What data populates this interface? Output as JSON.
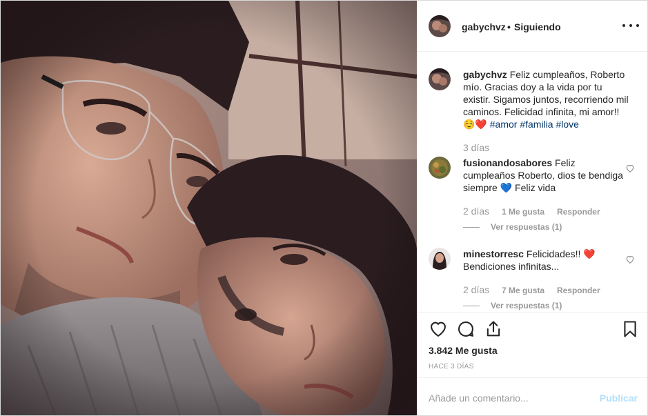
{
  "header": {
    "username": "gabychvz",
    "separator": "•",
    "follow_status": "Siguiendo"
  },
  "caption": {
    "username": "gabychvz",
    "text": "Feliz cumpleaños, Roberto mío. Gracias doy a la vida por tu existir. Sigamos juntos, recorriendo mil caminos. Felicidad infinita, mi amor!!",
    "emoji": "☺️❤️",
    "hashtags": [
      "#amor",
      "#familia",
      "#love"
    ],
    "time_ago": "3 días"
  },
  "comments": [
    {
      "username": "fusionandosabores",
      "text_before_emoji": "Feliz cumpleaños Roberto, dios te bendiga siempre",
      "emoji": "💙",
      "emoji_color": "#3bb7c9",
      "text_after_emoji": "Feliz vida",
      "time_ago": "2 días",
      "likes": "1 Me gusta",
      "reply": "Responder",
      "view_replies": "Ver respuestas (1)"
    },
    {
      "username": "minestorresc",
      "text_before_emoji": "Felicidades!!",
      "emoji": "❤️",
      "emoji_color": "#c0152f",
      "text_after_emoji": "Bendiciones infinitas...",
      "time_ago": "2 días",
      "likes": "7 Me gusta",
      "reply": "Responder",
      "view_replies": "Ver respuestas (1)"
    }
  ],
  "actions": {
    "like_icon": "heart-icon",
    "comment_icon": "comment-icon",
    "share_icon": "share-icon",
    "save_icon": "bookmark-icon",
    "like_count": "3.842 Me gusta",
    "posted_ago": "HACE 3 DÍAS"
  },
  "add_comment": {
    "placeholder": "Añade un comentario...",
    "post_label": "Publicar"
  },
  "colors": {
    "text": "#262626",
    "muted": "#999999",
    "hashtag": "#003569",
    "post_disabled": "#b2dffc",
    "border": "#efefef"
  }
}
